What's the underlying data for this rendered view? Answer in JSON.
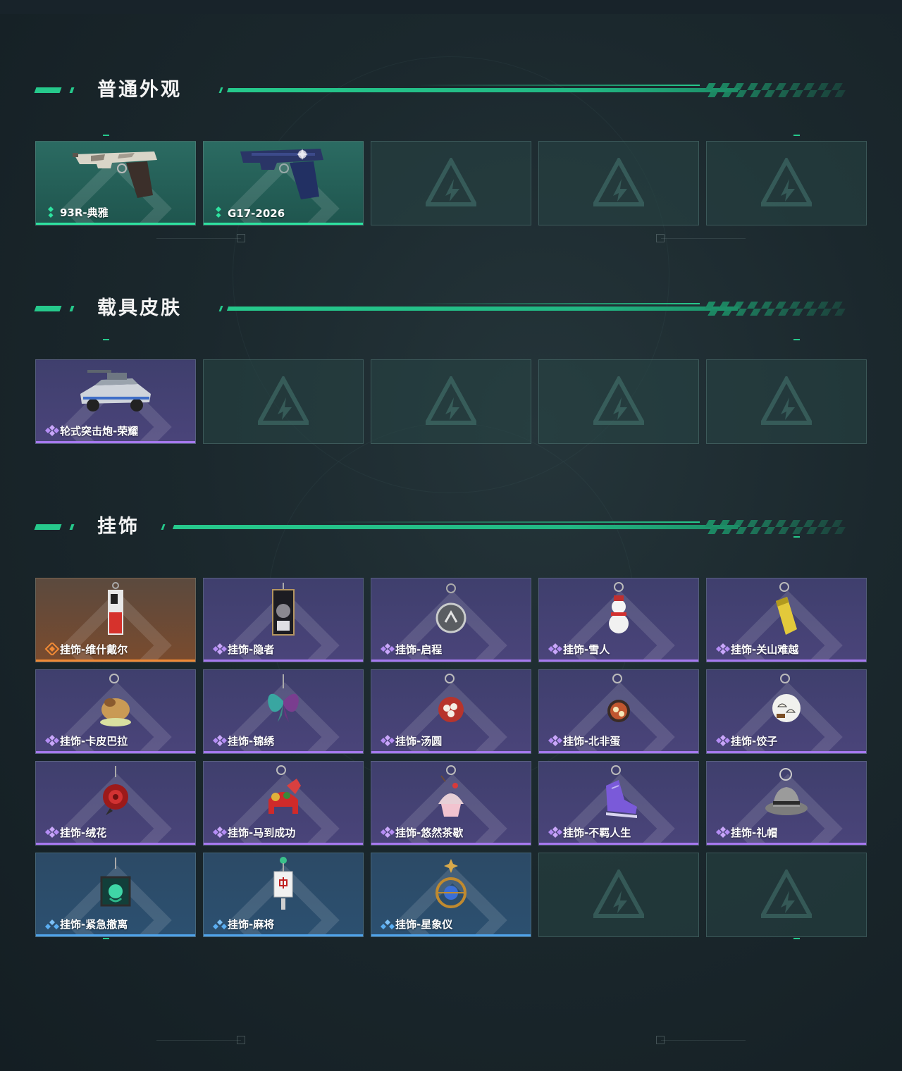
{
  "sections": {
    "weapon": {
      "title": "普通外观",
      "items": [
        {
          "name": "93R-典雅",
          "rarity": "green",
          "icon": "pistol-93r-icon"
        },
        {
          "name": "G17-2026",
          "rarity": "green",
          "icon": "pistol-g17-icon"
        }
      ],
      "empty_slots": 3
    },
    "vehicle": {
      "title": "载具皮肤",
      "items": [
        {
          "name": "轮式突击炮-荣耀",
          "rarity": "purple",
          "icon": "armored-vehicle-icon"
        }
      ],
      "empty_slots": 4
    },
    "charm": {
      "title": "挂饰",
      "items": [
        {
          "name": "挂饰-维什戴尔",
          "rarity": "orange",
          "icon": "tag-charm-icon"
        },
        {
          "name": "挂饰-隐者",
          "rarity": "purple",
          "icon": "card-charm-icon"
        },
        {
          "name": "挂饰-启程",
          "rarity": "purple",
          "icon": "round-badge-charm-icon"
        },
        {
          "name": "挂饰-雪人",
          "rarity": "purple",
          "icon": "snowman-charm-icon"
        },
        {
          "name": "挂饰-关山难越",
          "rarity": "purple",
          "icon": "cylinder-charm-icon"
        },
        {
          "name": "挂饰-卡皮巴拉",
          "rarity": "purple",
          "icon": "capybara-charm-icon"
        },
        {
          "name": "挂饰-锦绣",
          "rarity": "purple",
          "icon": "butterfly-charm-icon"
        },
        {
          "name": "挂饰-汤圆",
          "rarity": "purple",
          "icon": "bowl-charm-icon"
        },
        {
          "name": "挂饰-北非蛋",
          "rarity": "purple",
          "icon": "pan-charm-icon"
        },
        {
          "name": "挂饰-饺子",
          "rarity": "purple",
          "icon": "plate-charm-icon"
        },
        {
          "name": "挂饰-绒花",
          "rarity": "purple",
          "icon": "flower-charm-icon"
        },
        {
          "name": "挂饰-马到成功",
          "rarity": "purple",
          "icon": "horse-charm-icon"
        },
        {
          "name": "挂饰-悠然茶歇",
          "rarity": "purple",
          "icon": "cupcake-charm-icon"
        },
        {
          "name": "挂饰-不羁人生",
          "rarity": "purple",
          "icon": "sneaker-charm-icon"
        },
        {
          "name": "挂饰-礼帽",
          "rarity": "purple",
          "icon": "hat-charm-icon"
        },
        {
          "name": "挂饰-紧急撤离",
          "rarity": "blue",
          "icon": "cube-charm-icon"
        },
        {
          "name": "挂饰-麻将",
          "rarity": "blue",
          "icon": "mahjong-charm-icon"
        },
        {
          "name": "挂饰-星象仪",
          "rarity": "blue",
          "icon": "astrolabe-charm-icon"
        }
      ],
      "empty_slots": 2
    }
  },
  "colors": {
    "accent": "#26c98c",
    "green": "#2ee3a0",
    "purple": "#a779f0",
    "orange": "#f08a35",
    "blue": "#4fa3ea"
  }
}
